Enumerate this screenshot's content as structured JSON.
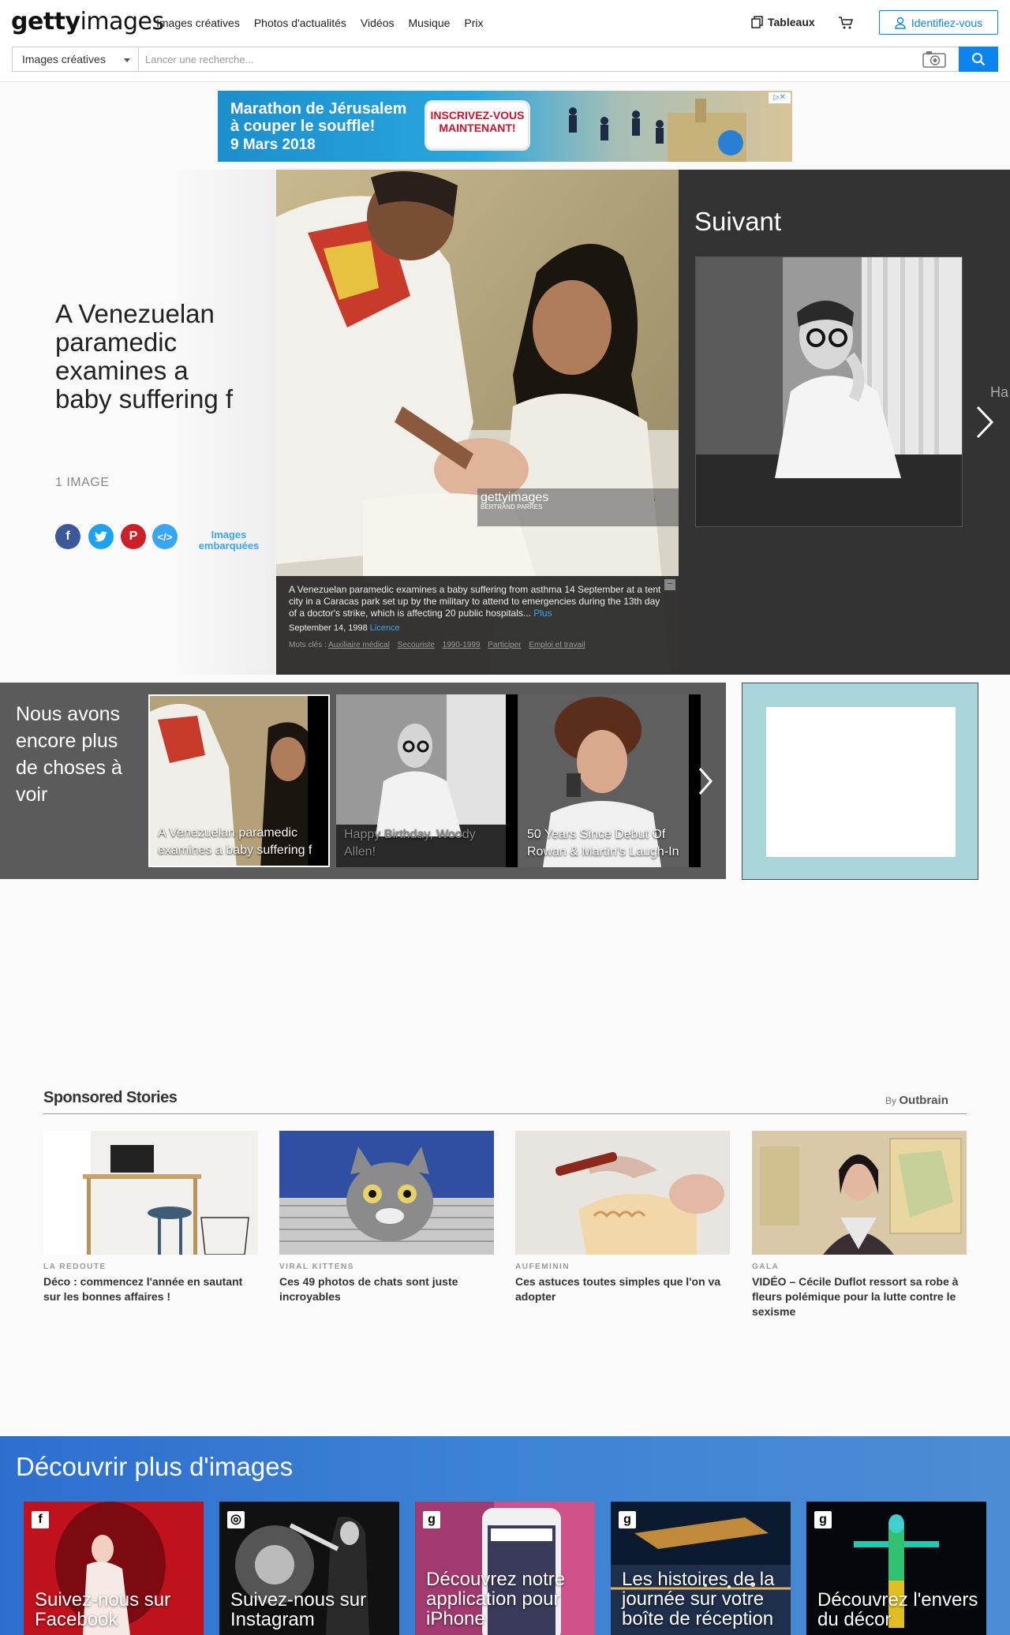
{
  "header": {
    "logo_bold": "getty",
    "logo_light": "images",
    "nav": [
      "Images créatives",
      "Photos d'actualités",
      "Vidéos",
      "Musique",
      "Prix"
    ],
    "boards_label": "Tableaux",
    "signin_label": "Identifiez-vous"
  },
  "search": {
    "type_selected": "Images créatives",
    "placeholder": "Lancer une recherche..."
  },
  "ad_banner": {
    "line1": "Marathon de Jérusalem",
    "line2": "à couper le souffle!",
    "date": "9 Mars 2018",
    "cta": "INSCRIVEZ-VOUS MAINTENANT!"
  },
  "hero": {
    "title": "A Venezuelan paramedic examines a baby suffering f",
    "count": "1 IMAGE",
    "embed_label": "Images embarquées",
    "watermark": "gettyimages",
    "watermark_credit": "BERTRAND PARRES",
    "caption": "A Venezuelan paramedic examines a baby suffering from asthma 14 September at a tent city in a Caracas park set up by the military to attend to emergencies during the 13th day of a doctor's strike, which is affecting 20 public hospitals...",
    "caption_more": "Plus",
    "date": "September 14, 1998",
    "license": "Licence",
    "keywords_label": "Mots clés :",
    "keywords": [
      "Auxiliaire médical",
      "Secouriste",
      "1990-1999",
      "Participer",
      "Emploi et travail"
    ]
  },
  "next_panel": {
    "title": "Suivant",
    "cut_text": "Ha"
  },
  "more_strip": {
    "title": "Nous avons encore plus de choses à voir",
    "items": [
      {
        "label": "A Venezuelan paramedic examines a baby suffering f"
      },
      {
        "label": "Happy Birthday, Woody Allen!"
      },
      {
        "label": "50 Years Since Debut Of Rowan & Martin's Laugh-In"
      }
    ]
  },
  "sponsored": {
    "heading": "Sponsored Stories",
    "by": "By",
    "provider": "Outbrain",
    "stories": [
      {
        "source": "LA REDOUTE",
        "title": "Déco : commencez l'année en sautant sur les bonnes affaires !"
      },
      {
        "source": "VIRAL KITTENS",
        "title": "Ces 49 photos de chats sont juste incroyables"
      },
      {
        "source": "AUFEMININ",
        "title": "Ces astuces toutes simples que l'on va adopter"
      },
      {
        "source": "GALA",
        "title": "VIDÉO – Cécile Duflot ressort sa robe à fleurs polémique pour la lutte contre le sexisme"
      }
    ]
  },
  "discover": {
    "title": "Découvrir plus d'images",
    "cards": [
      {
        "badge": "f",
        "label": "Suivez-nous sur Facebook"
      },
      {
        "badge": "◎",
        "label": "Suivez-nous sur Instagram"
      },
      {
        "badge": "g",
        "label": "Découvrez notre application pour iPhone"
      },
      {
        "badge": "g",
        "label": "Les histoires de la journée sur votre boîte de réception"
      },
      {
        "badge": "g",
        "label": "Découvrez l'envers du décor"
      }
    ]
  }
}
